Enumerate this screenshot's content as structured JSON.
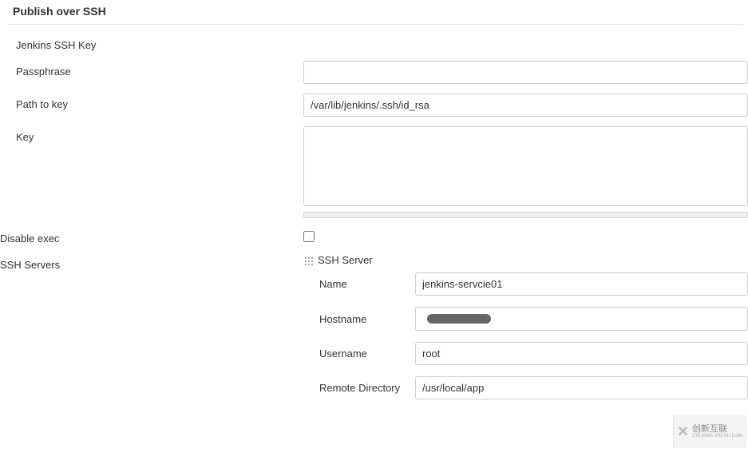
{
  "section": {
    "title": "Publish over SSH"
  },
  "jenkinsSshKey": {
    "label": "Jenkins SSH Key"
  },
  "passphrase": {
    "label": "Passphrase",
    "value": ""
  },
  "pathToKey": {
    "label": "Path to key",
    "value": "/var/lib/jenkins/.ssh/id_rsa"
  },
  "key": {
    "label": "Key",
    "value": ""
  },
  "disableExec": {
    "label": "Disable exec",
    "checked": false
  },
  "sshServers": {
    "label": "SSH Servers",
    "server": {
      "title": "SSH Server",
      "name": {
        "label": "Name",
        "value": "jenkins-servcie01"
      },
      "hostname": {
        "label": "Hostname",
        "value": ""
      },
      "username": {
        "label": "Username",
        "value": "root"
      },
      "remoteDirectory": {
        "label": "Remote Directory",
        "value": "/usr/local/app"
      }
    }
  },
  "watermark": {
    "brand": "创新互联",
    "sub": "CHUANG XIN HU LIAN"
  }
}
